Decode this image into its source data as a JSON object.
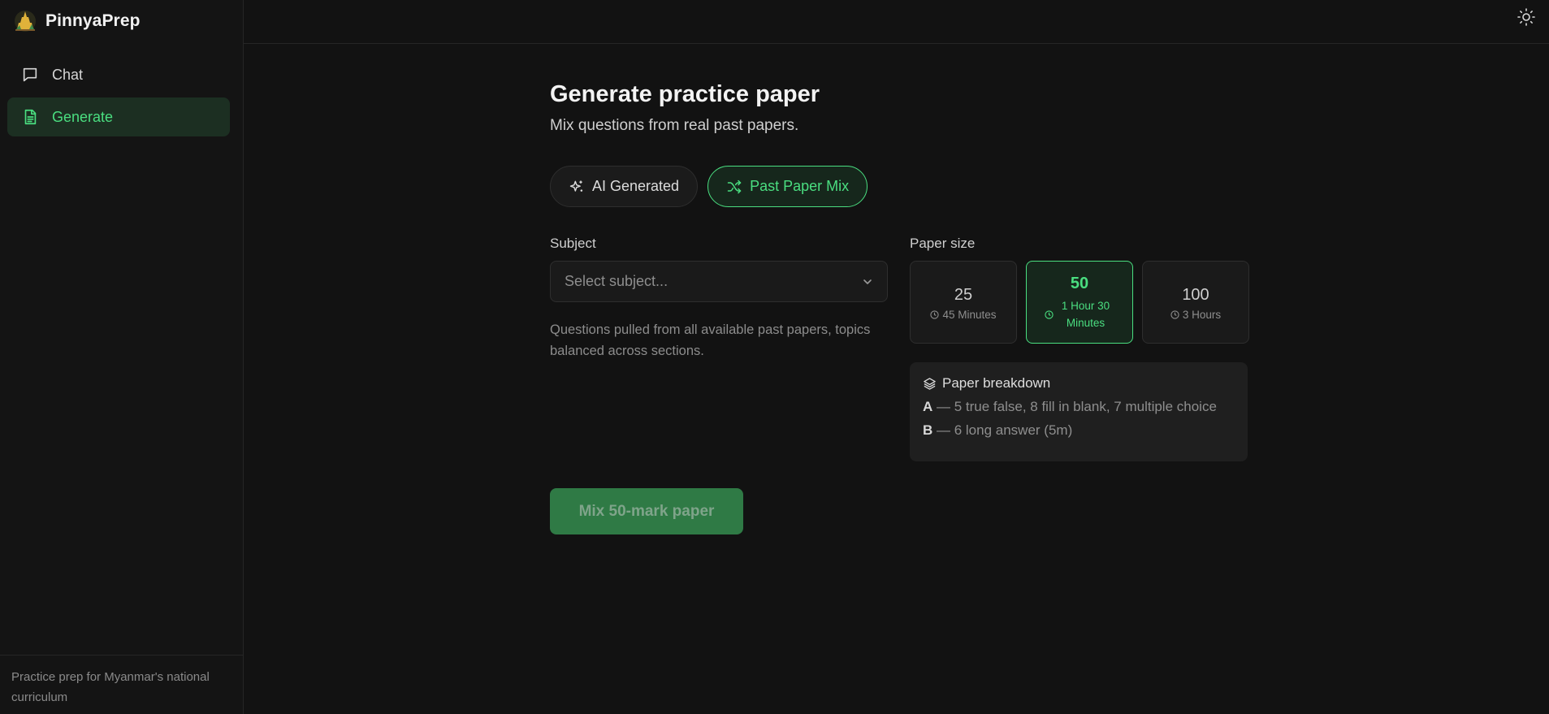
{
  "app": {
    "name": "PinnyaPrep",
    "footer_text": "Practice prep for Myanmar's national curriculum"
  },
  "sidebar": {
    "items": [
      {
        "label": "Chat",
        "icon": "chat-bubble-icon",
        "active": false
      },
      {
        "label": "Generate",
        "icon": "document-icon",
        "active": true
      }
    ]
  },
  "topbar": {
    "theme_icon": "sun-icon"
  },
  "main": {
    "title": "Generate practice paper",
    "subtitle": "Mix questions from real past papers.",
    "modes": [
      {
        "label": "AI Generated",
        "icon": "sparkles-icon",
        "active": false
      },
      {
        "label": "Past Paper Mix",
        "icon": "shuffle-icon",
        "active": true
      }
    ],
    "subject": {
      "label": "Subject",
      "placeholder": "Select subject...",
      "help": "Questions pulled from all available past papers, topics balanced across sections."
    },
    "paper_size": {
      "label": "Paper size",
      "options": [
        {
          "marks": "25",
          "duration": "45 Minutes",
          "active": false
        },
        {
          "marks": "50",
          "duration": "1 Hour 30 Minutes",
          "active": true
        },
        {
          "marks": "100",
          "duration": "3 Hours",
          "active": false
        }
      ]
    },
    "breakdown": {
      "title": "Paper breakdown",
      "rows": [
        {
          "section": "A",
          "text": " — 5 true false, 8 fill in blank, 7 multiple choice"
        },
        {
          "section": "B",
          "text": " — 6 long answer (5m)"
        }
      ]
    },
    "submit_label": "Mix 50-mark paper"
  },
  "colors": {
    "accent": "#4ade80",
    "background": "#121212",
    "active_bg": "#1c2f22",
    "button_bg": "#2f7a45"
  }
}
